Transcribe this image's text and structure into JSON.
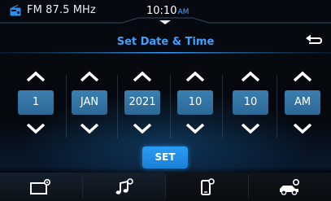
{
  "status": {
    "source": "FM 87.5 MHz",
    "time": "10:10",
    "ampm": "AM"
  },
  "page": {
    "title": "Set Date & Time"
  },
  "pickers": [
    {
      "field": "day",
      "value": "1"
    },
    {
      "field": "month",
      "value": "JAN"
    },
    {
      "field": "year",
      "value": "2021"
    },
    {
      "field": "hour",
      "value": "10"
    },
    {
      "field": "minute",
      "value": "10"
    },
    {
      "field": "period",
      "value": "AM"
    }
  ],
  "set_label": "SET",
  "nav": {
    "tabs": [
      {
        "icon": "display-settings-icon"
      },
      {
        "icon": "audio-settings-icon"
      },
      {
        "icon": "phone-settings-icon"
      },
      {
        "icon": "vehicle-settings-icon"
      }
    ]
  },
  "colors": {
    "accent": "#3ea0ff",
    "picker_box": "#347aab",
    "set_button": "#1f8ce6"
  }
}
